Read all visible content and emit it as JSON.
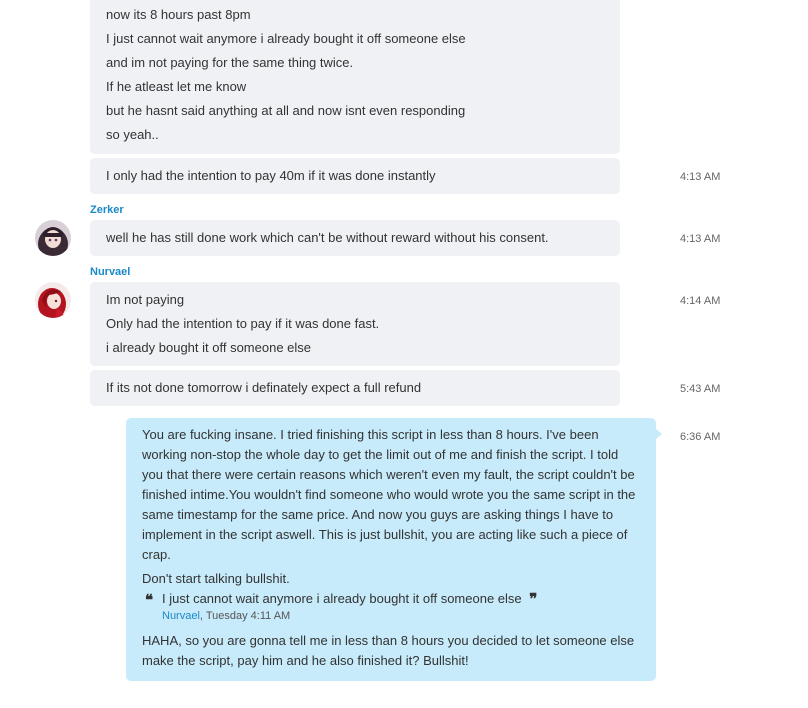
{
  "messages": {
    "block1": {
      "lines": [
        "now its 8 hours past 8pm",
        "I just cannot wait anymore i already bought it off someone else",
        "and im not paying for the same thing twice.",
        "If he atleast let me know",
        "but he hasnt said anything at all and now isnt even responding",
        "so yeah.."
      ]
    },
    "block2": {
      "text": "I only had the intention to pay 40m if it was done instantly",
      "time": "4:13 AM"
    },
    "zerker": {
      "sender": "Zerker",
      "text": "well he has still done work which can't be without reward without his consent.",
      "time": "4:13 AM"
    },
    "nurvael": {
      "sender": "Nurvael",
      "lines": [
        "Im not paying",
        "Only had the intention to pay if it was done fast.",
        "i already bought it off someone else"
      ],
      "time": "4:14 AM"
    },
    "refund": {
      "text": "If its not done tomorrow i definately expect a full refund",
      "time": "5:43 AM"
    },
    "own": {
      "time": "6:36 AM",
      "para1": "You are fucking insane. I tried finishing this script in less than 8 hours. I've been working non-stop the whole day to get the limit out of me and finish the script. I told you that there were certain reasons which weren't even my fault, the script couldn't be finished intime.You wouldn't find someone who would wrote you the same script in the same timestamp for the same price. And now you guys are asking things I have to implement in the script aswell. This is just bullshit, you are acting like such a piece of crap.",
      "para2": "Don't start talking bullshit.",
      "quote": {
        "open_mark": "❝",
        "close_mark": "❞",
        "text": "I just cannot wait anymore i already bought it off someone else",
        "author": "Nurvael",
        "meta": ", Tuesday 4:11 AM"
      },
      "para3": "HAHA, so you are gonna tell me in less than 8 hours you decided to let someone else make the script, pay him and he also finished it? Bullshit!"
    }
  },
  "colors": {
    "incoming_bubble": "#eff1f5",
    "outgoing_bubble": "#c7ebfa",
    "sender_name": "#1b88c8"
  }
}
